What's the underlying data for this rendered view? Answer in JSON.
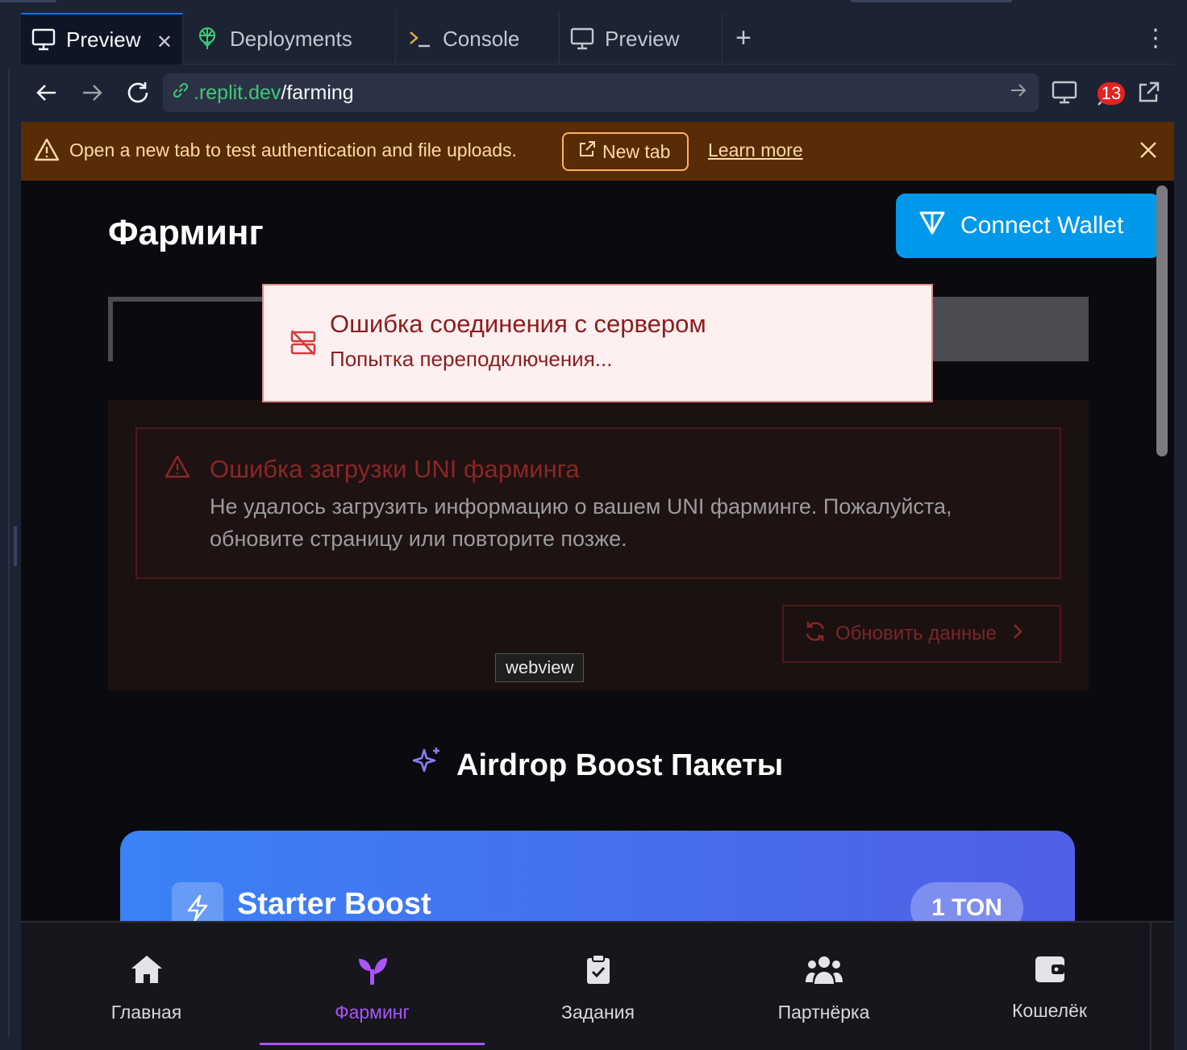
{
  "tabs": [
    {
      "label": "Preview",
      "icon": "monitor-icon",
      "active": true
    },
    {
      "label": "Deployments",
      "icon": "deployments-icon"
    },
    {
      "label": "Console",
      "icon": "terminal-icon"
    },
    {
      "label": "Preview",
      "icon": "monitor-icon"
    }
  ],
  "urlbar": {
    "domain": ".replit.dev",
    "path": "/farming",
    "devtools_count": "13"
  },
  "banner": {
    "message": "Open a new tab to test authentication and file uploads.",
    "new_tab": "New tab",
    "learn_more": "Learn more",
    "color": "#582c06"
  },
  "app": {
    "page_title": "Фарминг",
    "connect_wallet": "Connect Wallet",
    "toast": {
      "title": "Ошибка соединения с сервером",
      "description": "Попытка переподключения..."
    },
    "error": {
      "title": "Ошибка загрузки UNI фарминга",
      "description": "Не удалось загрузить информацию о вашем UNI фарминге. Пожалуйста, обновите страницу или повторите позже.",
      "refresh": "Обновить данные"
    },
    "tooltip": "webview",
    "section_title": "Airdrop Boost Пакеты",
    "boost": {
      "name": "Starter Boost",
      "price": "1 TON"
    },
    "nav": [
      {
        "label": "Главная",
        "icon": "home-icon"
      },
      {
        "label": "Фарминг",
        "icon": "sprout-icon",
        "active": true
      },
      {
        "label": "Задания",
        "icon": "clipboard-check-icon"
      },
      {
        "label": "Партнёрка",
        "icon": "users-icon"
      },
      {
        "label": "Кошелёк",
        "icon": "wallet-icon"
      }
    ],
    "accent_color": "#a855f7",
    "wallet_color": "#0098ea"
  }
}
